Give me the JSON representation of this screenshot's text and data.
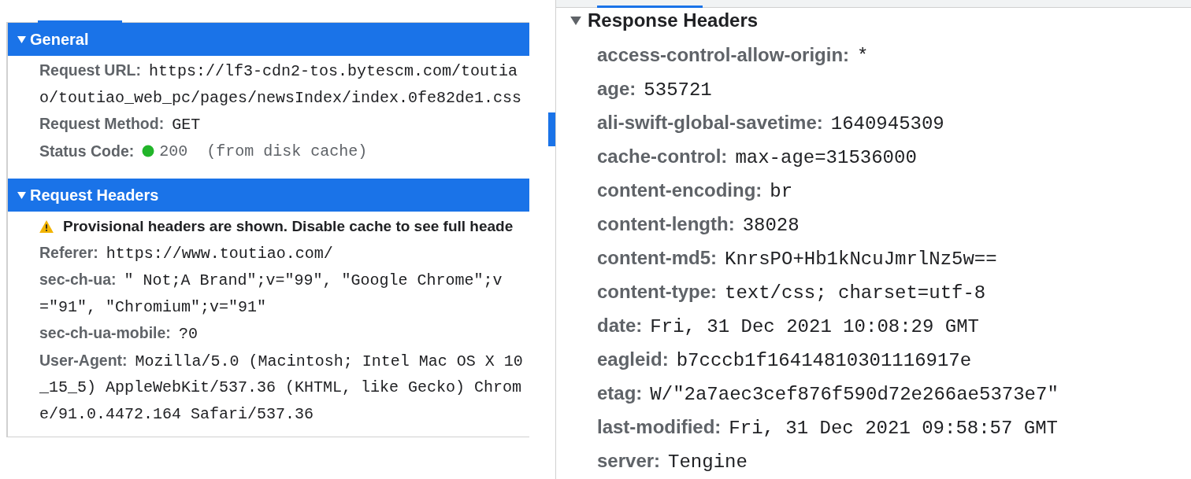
{
  "left": {
    "sections": [
      {
        "title": "General",
        "selected": true,
        "expanded": true,
        "rows": [
          {
            "kind": "pair",
            "name": "Request URL:",
            "value": "https://lf3-cdn2-tos.bytescm.com/toutiao/toutiao_web_pc/pages/newsIndex/index.0fe82de1.css"
          },
          {
            "kind": "pair",
            "name": "Request Method:",
            "value": "GET"
          },
          {
            "kind": "status",
            "name": "Status Code:",
            "value": "200",
            "note": "(from disk cache)"
          }
        ]
      },
      {
        "title": "Request Headers",
        "selected": true,
        "expanded": true,
        "rows": [
          {
            "kind": "warning",
            "value": "Provisional headers are shown. Disable cache to see full heade"
          },
          {
            "kind": "pair",
            "name": "Referer:",
            "value": "https://www.toutiao.com/"
          },
          {
            "kind": "pair",
            "name": "sec-ch-ua:",
            "value": "\" Not;A Brand\";v=\"99\", \"Google Chrome\";v=\"91\", \"Chromium\";v=\"91\""
          },
          {
            "kind": "pair",
            "name": "sec-ch-ua-mobile:",
            "value": "?0"
          },
          {
            "kind": "pair",
            "name": "User-Agent:",
            "value": "Mozilla/5.0 (Macintosh; Intel Mac OS X 10_15_5) AppleWebKit/537.36 (KHTML, like Gecko) Chrome/91.0.4472.164 Safari/537.36"
          }
        ]
      }
    ]
  },
  "right": {
    "sections": [
      {
        "title": "Response Headers",
        "selected": false,
        "expanded": true,
        "rows": [
          {
            "kind": "pair",
            "name": "access-control-allow-origin:",
            "value": "*"
          },
          {
            "kind": "pair",
            "name": "age:",
            "value": "535721"
          },
          {
            "kind": "pair",
            "name": "ali-swift-global-savetime:",
            "value": "1640945309"
          },
          {
            "kind": "pair",
            "name": "cache-control:",
            "value": "max-age=31536000"
          },
          {
            "kind": "pair",
            "name": "content-encoding:",
            "value": "br"
          },
          {
            "kind": "pair",
            "name": "content-length:",
            "value": "38028"
          },
          {
            "kind": "pair",
            "name": "content-md5:",
            "value": "KnrsPO+Hb1kNcuJmrlNz5w=="
          },
          {
            "kind": "pair",
            "name": "content-type:",
            "value": "text/css; charset=utf-8"
          },
          {
            "kind": "pair",
            "name": "date:",
            "value": "Fri, 31 Dec 2021 10:08:29 GMT"
          },
          {
            "kind": "pair",
            "name": "eagleid:",
            "value": "b7cccb1f16414810301116917e"
          },
          {
            "kind": "pair",
            "name": "etag:",
            "value": "W/\"2a7aec3cef876f590d72e266ae5373e7\""
          },
          {
            "kind": "pair",
            "name": "last-modified:",
            "value": "Fri, 31 Dec 2021 09:58:57 GMT"
          },
          {
            "kind": "pair",
            "name": "server:",
            "value": "Tengine"
          }
        ]
      }
    ]
  }
}
